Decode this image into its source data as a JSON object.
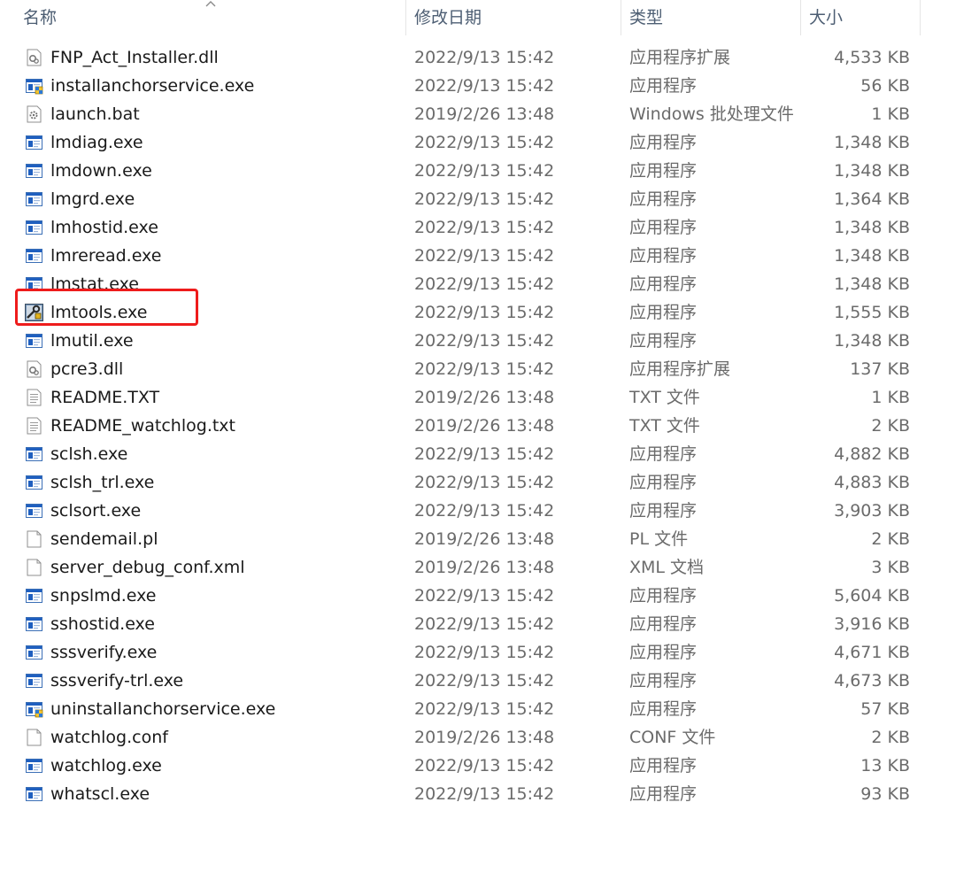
{
  "columns": {
    "name": "名称",
    "date": "修改日期",
    "type": "类型",
    "size": "大小"
  },
  "sort": {
    "column": "name",
    "direction": "ascending",
    "icon": "sort-up-icon"
  },
  "highlight": {
    "file": "lmtools.exe",
    "color": "#ee1c1c"
  },
  "files": [
    {
      "name": "FNP_Act_Installer.dll",
      "date": "2022/9/13 15:42",
      "type": "应用程序扩展",
      "size": "4,533 KB",
      "icon": "dll-icon"
    },
    {
      "name": "installanchorservice.exe",
      "date": "2022/9/13 15:42",
      "type": "应用程序",
      "size": "56 KB",
      "icon": "installer-exe-icon"
    },
    {
      "name": "launch.bat",
      "date": "2019/2/26 13:48",
      "type": "Windows 批处理文件",
      "size": "1 KB",
      "icon": "batch-file-icon"
    },
    {
      "name": "lmdiag.exe",
      "date": "2022/9/13 15:42",
      "type": "应用程序",
      "size": "1,348 KB",
      "icon": "exe-icon"
    },
    {
      "name": "lmdown.exe",
      "date": "2022/9/13 15:42",
      "type": "应用程序",
      "size": "1,348 KB",
      "icon": "exe-icon"
    },
    {
      "name": "lmgrd.exe",
      "date": "2022/9/13 15:42",
      "type": "应用程序",
      "size": "1,364 KB",
      "icon": "exe-icon"
    },
    {
      "name": "lmhostid.exe",
      "date": "2022/9/13 15:42",
      "type": "应用程序",
      "size": "1,348 KB",
      "icon": "exe-icon"
    },
    {
      "name": "lmreread.exe",
      "date": "2022/9/13 15:42",
      "type": "应用程序",
      "size": "1,348 KB",
      "icon": "exe-icon"
    },
    {
      "name": "lmstat.exe",
      "date": "2022/9/13 15:42",
      "type": "应用程序",
      "size": "1,348 KB",
      "icon": "exe-icon"
    },
    {
      "name": "lmtools.exe",
      "date": "2022/9/13 15:42",
      "type": "应用程序",
      "size": "1,555 KB",
      "icon": "lmtools-app-icon"
    },
    {
      "name": "lmutil.exe",
      "date": "2022/9/13 15:42",
      "type": "应用程序",
      "size": "1,348 KB",
      "icon": "exe-icon"
    },
    {
      "name": "pcre3.dll",
      "date": "2022/9/13 15:42",
      "type": "应用程序扩展",
      "size": "137 KB",
      "icon": "dll-icon"
    },
    {
      "name": "README.TXT",
      "date": "2019/2/26 13:48",
      "type": "TXT 文件",
      "size": "1 KB",
      "icon": "text-file-icon"
    },
    {
      "name": "README_watchlog.txt",
      "date": "2019/2/26 13:48",
      "type": "TXT 文件",
      "size": "2 KB",
      "icon": "text-file-icon"
    },
    {
      "name": "sclsh.exe",
      "date": "2022/9/13 15:42",
      "type": "应用程序",
      "size": "4,882 KB",
      "icon": "exe-icon"
    },
    {
      "name": "sclsh_trl.exe",
      "date": "2022/9/13 15:42",
      "type": "应用程序",
      "size": "4,883 KB",
      "icon": "exe-icon"
    },
    {
      "name": "sclsort.exe",
      "date": "2022/9/13 15:42",
      "type": "应用程序",
      "size": "3,903 KB",
      "icon": "exe-icon"
    },
    {
      "name": "sendemail.pl",
      "date": "2019/2/26 13:48",
      "type": "PL 文件",
      "size": "2 KB",
      "icon": "blank-file-icon"
    },
    {
      "name": "server_debug_conf.xml",
      "date": "2019/2/26 13:48",
      "type": "XML 文档",
      "size": "3 KB",
      "icon": "blank-file-icon"
    },
    {
      "name": "snpslmd.exe",
      "date": "2022/9/13 15:42",
      "type": "应用程序",
      "size": "5,604 KB",
      "icon": "exe-icon"
    },
    {
      "name": "sshostid.exe",
      "date": "2022/9/13 15:42",
      "type": "应用程序",
      "size": "3,916 KB",
      "icon": "exe-icon"
    },
    {
      "name": "sssverify.exe",
      "date": "2022/9/13 15:42",
      "type": "应用程序",
      "size": "4,671 KB",
      "icon": "exe-icon"
    },
    {
      "name": "sssverify-trl.exe",
      "date": "2022/9/13 15:42",
      "type": "应用程序",
      "size": "4,673 KB",
      "icon": "exe-icon"
    },
    {
      "name": "uninstallanchorservice.exe",
      "date": "2022/9/13 15:42",
      "type": "应用程序",
      "size": "57 KB",
      "icon": "installer-exe-icon"
    },
    {
      "name": "watchlog.conf",
      "date": "2019/2/26 13:48",
      "type": "CONF 文件",
      "size": "2 KB",
      "icon": "blank-file-icon"
    },
    {
      "name": "watchlog.exe",
      "date": "2022/9/13 15:42",
      "type": "应用程序",
      "size": "13 KB",
      "icon": "exe-icon"
    },
    {
      "name": "whatscl.exe",
      "date": "2022/9/13 15:42",
      "type": "应用程序",
      "size": "93 KB",
      "icon": "exe-icon"
    }
  ]
}
